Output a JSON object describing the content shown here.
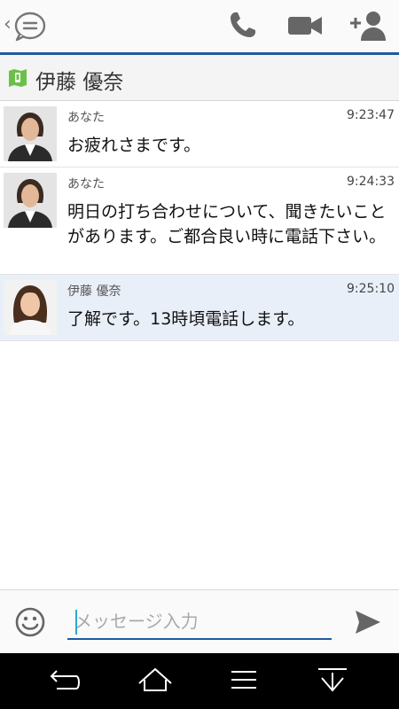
{
  "header": {
    "contact_name": "伊藤 優奈"
  },
  "messages": [
    {
      "sender": "あなた",
      "time": "9:23:47",
      "text": "お疲れさまです。",
      "from": "self"
    },
    {
      "sender": "あなた",
      "time": "9:24:33",
      "text": "明日の打ち合わせについて、聞きたいことがあります。ご都合良い時に電話下さい。",
      "from": "self"
    },
    {
      "sender": "伊藤 優奈",
      "time": "9:25:10",
      "text": "了解です。13時頃電話します。",
      "from": "other"
    }
  ],
  "input": {
    "placeholder": "メッセージ入力",
    "value": ""
  },
  "icons": {
    "back": "back-chevron-icon",
    "chat": "chat-bubble-icon",
    "call": "phone-icon",
    "video": "video-camera-icon",
    "add_user": "add-user-icon",
    "status": "status-icon",
    "emoji": "emoji-icon",
    "send": "send-icon",
    "nav_back": "nav-back-icon",
    "nav_home": "nav-home-icon",
    "nav_menu": "nav-menu-icon",
    "nav_hide": "nav-hide-keyboard-icon"
  },
  "colors": {
    "accent": "#1d5aa0",
    "incoming_bg": "#e9eff8",
    "status_green": "#6cc04a"
  }
}
